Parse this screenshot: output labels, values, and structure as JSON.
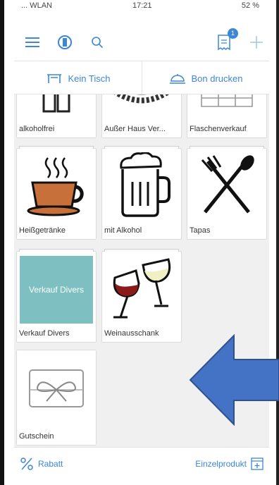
{
  "status": {
    "carrier": "... WLAN",
    "time": "17:21",
    "battery": "52 %"
  },
  "nav": {
    "receipt_badge": "1"
  },
  "toolbar": {
    "table_label": "Kein Tisch",
    "print_label": "Bon drucken"
  },
  "tiles": [
    {
      "label": "alkoholfrei",
      "icon": "bottles-icon"
    },
    {
      "label": "Außer Haus Ver...",
      "icon": "basket-icon"
    },
    {
      "label": "Flaschenverkauf",
      "icon": "crates-icon"
    },
    {
      "label": "Heißgetränke",
      "icon": "coffee-cup-icon"
    },
    {
      "label": "mit Alkohol",
      "icon": "beer-mug-icon"
    },
    {
      "label": "Tapas",
      "icon": "cutlery-icon"
    },
    {
      "label": "Verkauf Divers",
      "icon": "teal-tile",
      "picture_text": "Verkauf Divers"
    },
    {
      "label": "Weinausschank",
      "icon": "wine-glasses-icon"
    },
    {
      "label": "Gutschein",
      "icon": "gift-card-icon"
    }
  ],
  "bottom": {
    "discount_label": "Rabatt",
    "single_product_label": "Einzelprodukt"
  },
  "colors": {
    "accent": "#3d86d8",
    "teal": "#7ec0c2",
    "arrow": "#4472c4",
    "coffee": "#c8703a"
  }
}
